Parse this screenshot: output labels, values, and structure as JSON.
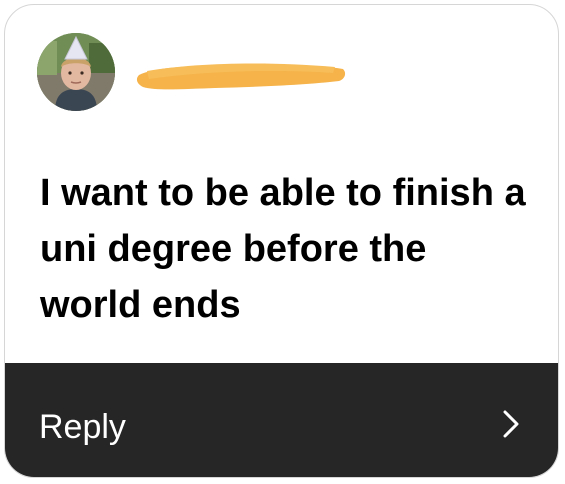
{
  "story_reply": {
    "message": "I want to be able to finish a uni degree before the world ends",
    "reply_label": "Reply"
  },
  "icons": {
    "avatar": "profile-photo",
    "redaction": "orange-scribble",
    "chevron": "chevron-right-icon"
  },
  "colors": {
    "card_background": "#ffffff",
    "reply_bar": "#262626",
    "redaction": "#f5b34a",
    "text": "#000000",
    "reply_text": "#ffffff"
  }
}
